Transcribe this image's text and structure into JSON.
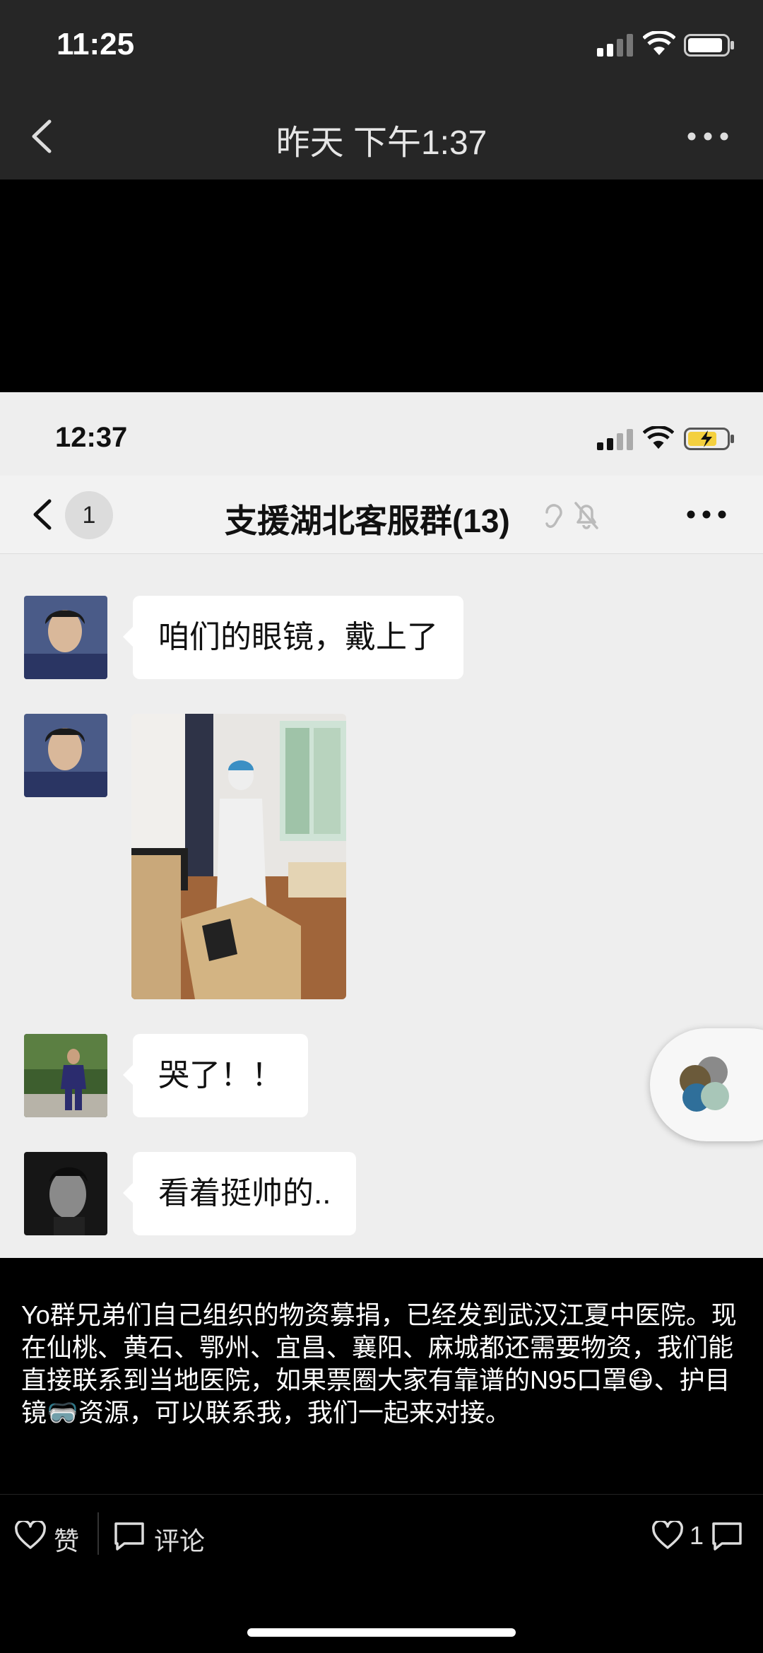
{
  "status_bar": {
    "time": "11:25"
  },
  "header": {
    "title": "昨天 下午1:37"
  },
  "screenshot": {
    "status_bar": {
      "time": "12:37"
    },
    "nav": {
      "unread_count": "1",
      "chat_title": "支援湖北客服群(13)"
    },
    "messages": [
      {
        "type": "text",
        "text": "咱们的眼镜，戴上了"
      },
      {
        "type": "image"
      },
      {
        "type": "text",
        "text": "哭了！！"
      },
      {
        "type": "text",
        "text": "看着挺帅的.."
      }
    ]
  },
  "post": {
    "caption": "Yo群兄弟们自己组织的物资募捐，已经发到武汉江夏中医院。现在仙桃、黄石、鄂州、宜昌、襄阳、麻城都还需要物资，我们能直接联系到当地医院，如果票圈大家有靠谱的N95口罩😷、护目镜🥽资源，可以联系我，我们一起来对接。"
  },
  "actions": {
    "like_label": "赞",
    "comment_label": "评论",
    "like_count": "1"
  },
  "colors": {
    "dark_bar": "#262626",
    "chat_bg": "#eeeeee",
    "bubble": "#ffffff"
  }
}
